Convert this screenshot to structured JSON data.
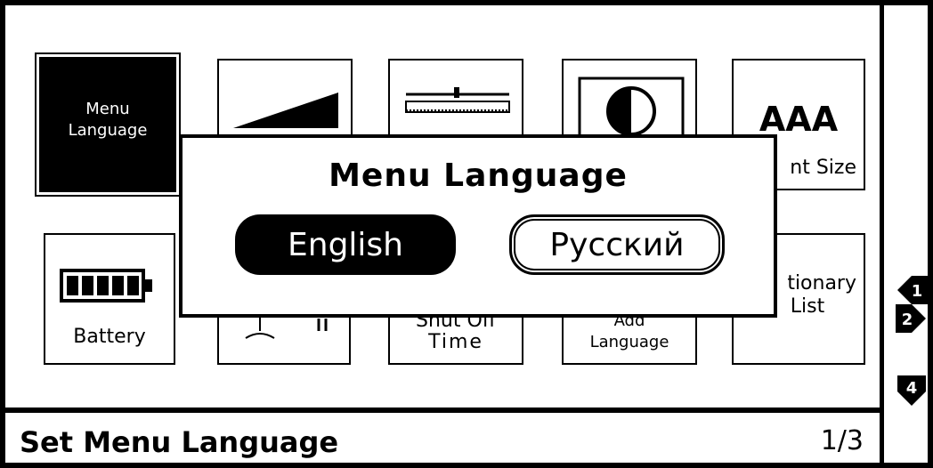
{
  "tiles": {
    "menu_language": {
      "label_line1": "Menu",
      "label_line2": "Language"
    },
    "font_size": {
      "label_big": "AAA",
      "label": "nt Size"
    },
    "battery": {
      "label": "Battery"
    },
    "shut_off": {
      "label_top": "Shut Off",
      "label": "Time"
    },
    "add_language": {
      "label_top": "Add",
      "label": "Language"
    },
    "dictionary_list": {
      "label_top": "tionary",
      "label": "List"
    }
  },
  "dialog": {
    "title": "Menu Language",
    "options": [
      {
        "label": "English",
        "selected": true
      },
      {
        "label": "Русский",
        "selected": false
      }
    ]
  },
  "status_bar": {
    "title": "Set Menu Language",
    "page": "1/3"
  },
  "side_keys": {
    "icons": [
      "key-1-left-icon",
      "key-2-right-icon",
      "key-4-down-icon"
    ]
  },
  "colors": {
    "foreground": "#000000",
    "background": "#ffffff"
  }
}
